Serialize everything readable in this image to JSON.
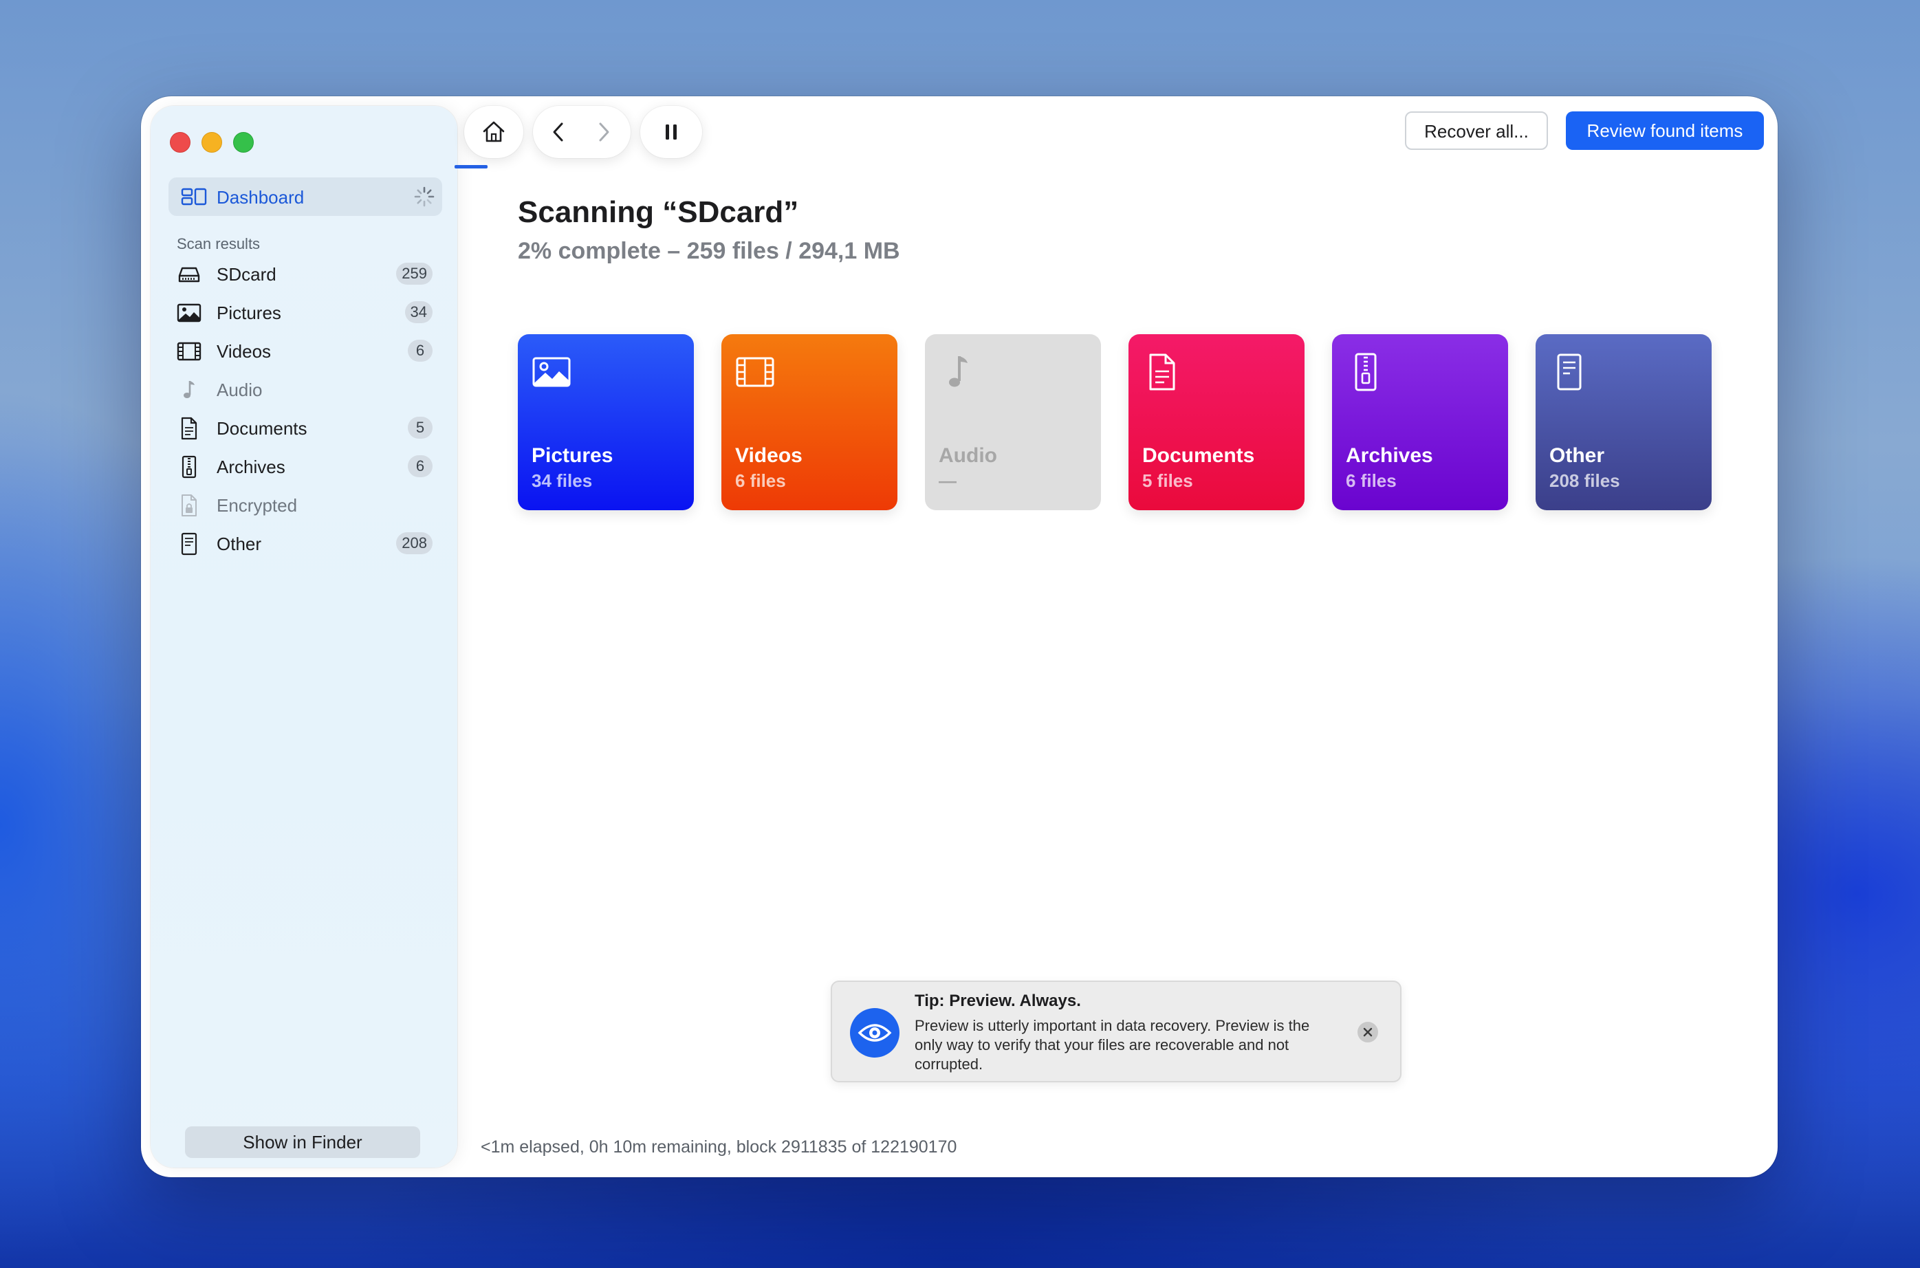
{
  "sidebar": {
    "dashboard_label": "Dashboard",
    "section_title": "Scan results",
    "items": [
      {
        "label": "SDcard",
        "count": "259",
        "icon": "drive-icon"
      },
      {
        "label": "Pictures",
        "count": "34",
        "icon": "picture-icon"
      },
      {
        "label": "Videos",
        "count": "6",
        "icon": "film-icon"
      },
      {
        "label": "Audio",
        "count": "",
        "icon": "music-note-icon"
      },
      {
        "label": "Documents",
        "count": "5",
        "icon": "document-icon"
      },
      {
        "label": "Archives",
        "count": "6",
        "icon": "archive-icon"
      },
      {
        "label": "Encrypted",
        "count": "",
        "icon": "lock-document-icon"
      },
      {
        "label": "Other",
        "count": "208",
        "icon": "other-file-icon"
      }
    ],
    "show_in_finder": "Show in Finder"
  },
  "toolbar": {
    "recover_all": "Recover all...",
    "review_found": "Review found items"
  },
  "main": {
    "title": "Scanning “SDcard”",
    "subtitle": "2% complete – 259 files / 294,1 MB",
    "progress_fraction": 0.02,
    "cards": [
      {
        "name": "Pictures",
        "count": "34 files",
        "color": "#1a35f5"
      },
      {
        "name": "Videos",
        "count": "6 files",
        "color": "#f25a0a"
      },
      {
        "name": "Audio",
        "count": "—",
        "color": "#dedede"
      },
      {
        "name": "Documents",
        "count": "5 files",
        "color": "#ef1252"
      },
      {
        "name": "Archives",
        "count": "6 files",
        "color": "#7a18dc"
      },
      {
        "name": "Other",
        "count": "208 files",
        "color": "#4a55a6"
      }
    ]
  },
  "tip": {
    "title": "Tip: Preview. Always.",
    "text": "Preview is utterly important in data recovery. Preview is the only way to verify that your files are recoverable and not corrupted."
  },
  "status": "<1m elapsed, 0h 10m remaining, block 2911835 of 122190170",
  "colors": {
    "accent": "#1a63f4",
    "sidebar_bg": "#e7f3fb"
  }
}
